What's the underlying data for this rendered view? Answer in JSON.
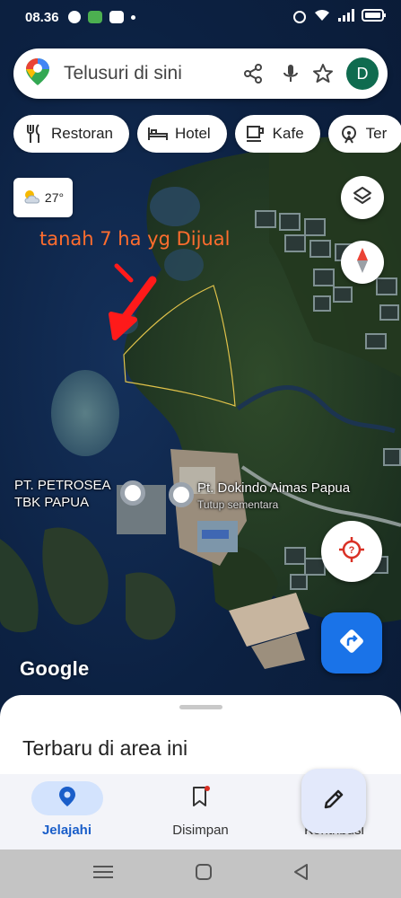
{
  "status_bar": {
    "time": "08.36"
  },
  "search": {
    "placeholder": "Telusuri di sini",
    "avatar_letter": "D"
  },
  "chips": [
    {
      "label": "Restoran",
      "icon": "fork-knife-icon"
    },
    {
      "label": "Hotel",
      "icon": "bed-icon"
    },
    {
      "label": "Kafe",
      "icon": "coffee-cup-icon"
    },
    {
      "label": "Ter",
      "icon": "attraction-icon"
    }
  ],
  "weather": {
    "temperature": "27°"
  },
  "annotation": {
    "text": "tanah 7 ha yg Dijual",
    "color": "#ff6d2e"
  },
  "places": [
    {
      "name_line1": "PT. PETROSEA",
      "name_line2": "TBK PAPUA"
    },
    {
      "name": "Pt. Dokindo Aimas Papua",
      "status": "Tutup sementara"
    }
  ],
  "map": {
    "attribution": "Google"
  },
  "bottom_sheet": {
    "title": "Terbaru di area ini"
  },
  "nav": {
    "items": [
      {
        "label": "Jelajahi",
        "icon": "location-pin-icon",
        "active": true
      },
      {
        "label": "Disimpan",
        "icon": "bookmark-icon",
        "active": false
      },
      {
        "label": "Kontribusi",
        "icon": "plus-circle-icon",
        "active": false
      }
    ]
  },
  "colors": {
    "accent": "#1a73e8",
    "nav_active_pill": "#d3e3fd",
    "annotation": "#ff6d2e"
  }
}
